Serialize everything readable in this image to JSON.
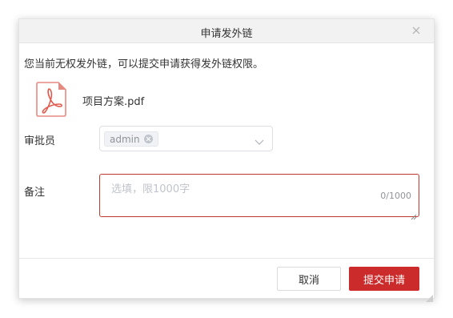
{
  "dialog": {
    "title": "申请发外链",
    "close_icon": "close-icon",
    "notice": "您当前无权发外链，可以提交申请获得发外链权限。"
  },
  "file": {
    "icon": "pdf-file-icon",
    "name": "项目方案.pdf"
  },
  "form": {
    "approver_label": "审批员",
    "approver_tags": [
      "admin"
    ],
    "remark_label": "备注",
    "remark_value": "",
    "remark_placeholder": "选填，限1000字",
    "remark_counter": "0/1000"
  },
  "buttons": {
    "cancel": "取消",
    "submit": "提交申请"
  },
  "colors": {
    "accent": "#cc2b2b",
    "pdf_icon": "#e05a4e",
    "header_bg": "#f2f2f2"
  }
}
